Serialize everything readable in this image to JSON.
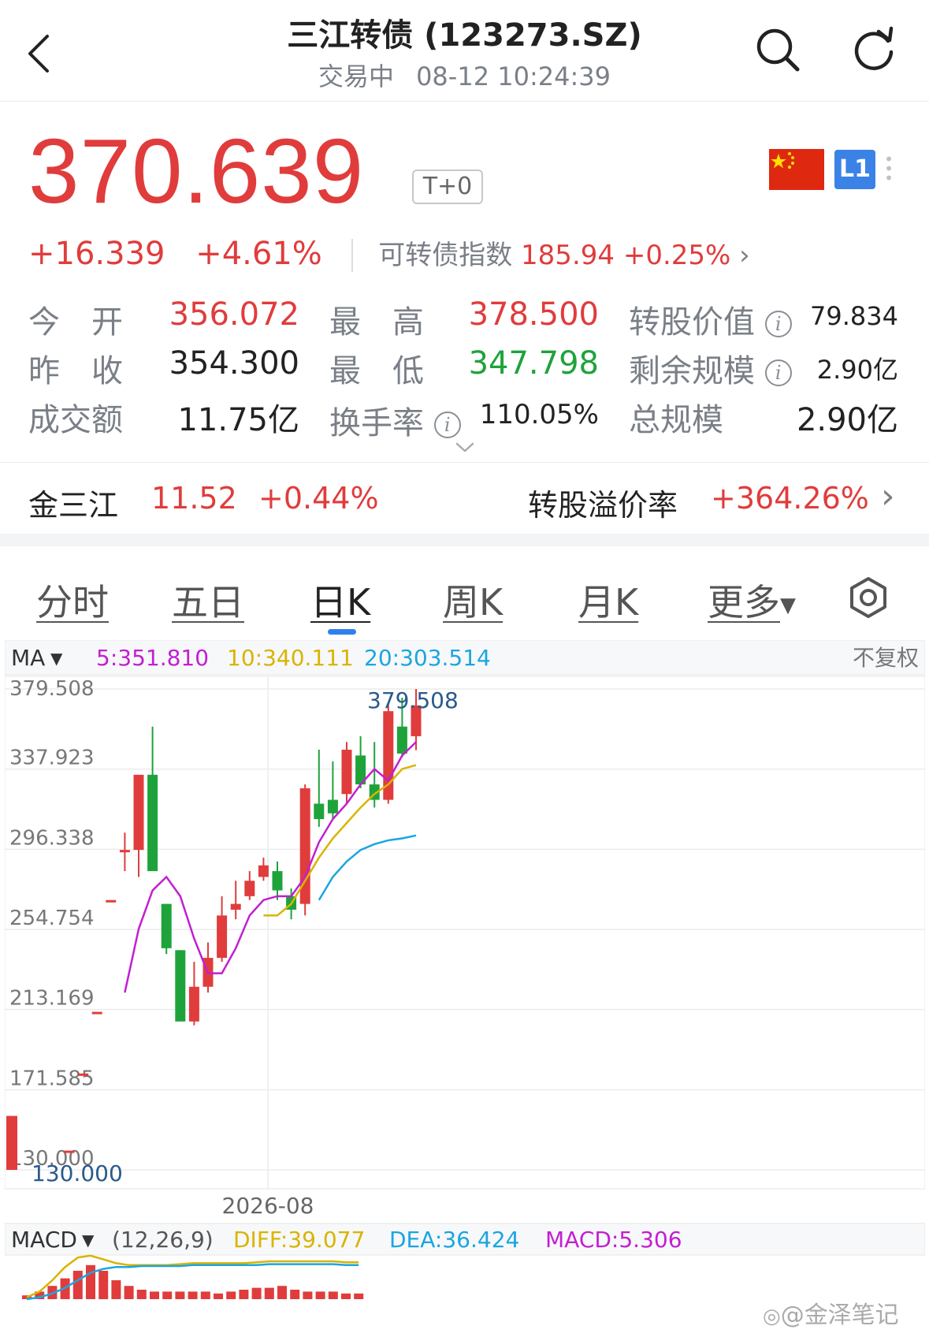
{
  "header": {
    "title": "三江转债 (123273.SZ)",
    "status": "交易中",
    "datetime": "08-12 10:24:39"
  },
  "quote": {
    "price": "370.639",
    "t0_badge": "T+0",
    "level_badge": "L1",
    "change": "+16.339",
    "change_pct": "+4.61%",
    "index_label": "可转债指数",
    "index_value": "185.94",
    "index_change": "+0.25%"
  },
  "stats": {
    "open_label": "今　开",
    "open": "356.072",
    "high_label": "最　高",
    "high": "378.500",
    "conv_value_label": "转股价值",
    "conv_value": "79.834",
    "prev_close_label": "昨　收",
    "prev_close": "354.300",
    "low_label": "最　低",
    "low": "347.798",
    "remaining_label": "剩余规模",
    "remaining": "2.90亿",
    "turnover_label": "成交额",
    "turnover": "11.75亿",
    "turnover_rate_label": "换手率",
    "turnover_rate": "110.05%",
    "total_label": "总规模",
    "total": "2.90亿"
  },
  "underlying": {
    "name": "金三江",
    "price": "11.52",
    "change_pct": "+0.44%",
    "premium_label": "转股溢价率",
    "premium": "+364.26%"
  },
  "tabs": [
    "分时",
    "五日",
    "日K",
    "周K",
    "月K",
    "更多"
  ],
  "active_tab": "日K",
  "colors": {
    "up": "#e03c3c",
    "down": "#1ea33b",
    "ma5": "#c21fd1",
    "ma10": "#d9b400",
    "ma20": "#1aa6e0",
    "accent": "#2f80ed"
  },
  "chart_data": {
    "type": "candlestick",
    "ma_label": "MA",
    "ma_values": [
      {
        "name": "5",
        "value": "351.810"
      },
      {
        "name": "10",
        "value": "340.111"
      },
      {
        "name": "20",
        "value": "303.514"
      }
    ],
    "adjust_label": "不复权",
    "y_ticks": [
      "379.508",
      "337.923",
      "296.338",
      "254.754",
      "213.169",
      "171.585",
      "130.000"
    ],
    "ylim": [
      130.0,
      379.508
    ],
    "max_label": "379.508",
    "min_label": "130.000",
    "x_label": "2026-08",
    "candles": [
      {
        "o": 140,
        "h": 140,
        "c": 140,
        "l": 140
      },
      {
        "o": 180,
        "h": 180,
        "c": 180,
        "l": 180
      },
      {
        "o": 212,
        "h": 212,
        "c": 212,
        "l": 212
      },
      {
        "o": 270,
        "h": 270,
        "c": 270,
        "l": 270
      },
      {
        "o": 296,
        "h": 305,
        "c": 296,
        "l": 285
      },
      {
        "o": 296,
        "h": 335,
        "c": 335,
        "l": 282
      },
      {
        "o": 335,
        "h": 360,
        "c": 285,
        "l": 285
      },
      {
        "o": 268,
        "h": 268,
        "c": 245,
        "l": 242
      },
      {
        "o": 244,
        "h": 244,
        "c": 207,
        "l": 207
      },
      {
        "o": 207,
        "h": 238,
        "c": 225,
        "l": 205
      },
      {
        "o": 225,
        "h": 248,
        "c": 240,
        "l": 222
      },
      {
        "o": 240,
        "h": 272,
        "c": 262,
        "l": 238
      },
      {
        "o": 265,
        "h": 280,
        "c": 268,
        "l": 260
      },
      {
        "o": 272,
        "h": 285,
        "c": 280,
        "l": 270
      },
      {
        "o": 282,
        "h": 292,
        "c": 288,
        "l": 280
      },
      {
        "o": 285,
        "h": 290,
        "c": 275,
        "l": 270
      },
      {
        "o": 272,
        "h": 276,
        "c": 265,
        "l": 260
      },
      {
        "o": 268,
        "h": 330,
        "c": 328,
        "l": 262
      },
      {
        "o": 320,
        "h": 348,
        "c": 312,
        "l": 308
      },
      {
        "o": 322,
        "h": 342,
        "c": 315,
        "l": 312
      },
      {
        "o": 325,
        "h": 352,
        "c": 348,
        "l": 320
      },
      {
        "o": 345,
        "h": 355,
        "c": 330,
        "l": 328
      },
      {
        "o": 330,
        "h": 352,
        "c": 322,
        "l": 318
      },
      {
        "o": 322,
        "h": 372,
        "c": 368,
        "l": 320
      },
      {
        "o": 360,
        "h": 375,
        "c": 346,
        "l": 344
      },
      {
        "o": 355,
        "h": 379.5,
        "c": 371,
        "l": 347.8
      }
    ],
    "ma5": [
      null,
      null,
      null,
      null,
      222,
      255,
      275,
      282,
      272,
      250,
      232,
      232,
      245,
      262,
      270,
      272,
      272,
      282,
      300,
      312,
      320,
      330,
      338,
      332,
      345,
      352
    ],
    "ma10": [
      null,
      null,
      null,
      null,
      null,
      null,
      null,
      null,
      null,
      null,
      null,
      null,
      null,
      null,
      262,
      262,
      268,
      280,
      292,
      302,
      310,
      318,
      325,
      330,
      338,
      340
    ],
    "ma20": [
      null,
      null,
      null,
      null,
      null,
      null,
      null,
      null,
      null,
      null,
      null,
      null,
      null,
      null,
      null,
      null,
      null,
      null,
      270,
      282,
      290,
      296,
      299,
      301,
      302,
      303.5
    ],
    "macd": {
      "label": "MACD",
      "params": "(12,26,9)",
      "diff_label": "DIFF",
      "diff": "39.077",
      "dea_label": "DEA",
      "dea": "36.424",
      "macd_label": "MACD",
      "macd": "5.306",
      "hist": [
        4,
        8,
        14,
        22,
        30,
        36,
        30,
        20,
        14,
        10,
        8,
        8,
        8,
        8,
        8,
        6,
        8,
        10,
        12,
        12,
        14,
        10,
        8,
        8,
        8,
        6,
        6
      ],
      "diff_series": [
        2,
        8,
        20,
        34,
        44,
        46,
        42,
        38,
        36,
        36,
        36,
        36,
        37,
        38,
        38,
        38,
        38,
        38,
        39,
        40,
        40,
        40,
        40,
        40,
        40,
        39,
        39
      ],
      "dea_series": [
        0,
        2,
        6,
        12,
        20,
        28,
        32,
        34,
        34,
        35,
        35,
        35,
        35,
        36,
        36,
        36,
        36,
        36,
        36,
        37,
        37,
        37,
        37,
        37,
        37,
        36,
        36
      ]
    }
  },
  "watermark": "@金泽笔记"
}
